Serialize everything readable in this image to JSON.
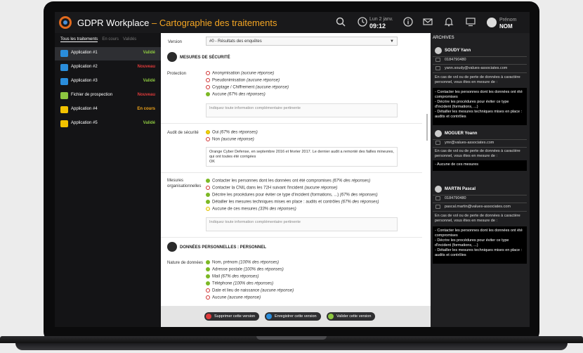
{
  "header": {
    "title_main": "GDPR Workplace",
    "title_dash": " – ",
    "title_sub": "Cartographie des traitements",
    "clock_date": "Lun 2 janv.",
    "clock_time": "09:12",
    "user_firstname": "Prénom",
    "user_lastname": "NOM"
  },
  "left_tabs": [
    "Tous les traitements",
    "En cours",
    "Validés"
  ],
  "applications": [
    {
      "name": "Application #1",
      "status": "Validé",
      "status_color": "#8cc640",
      "icon": "folder-yellow"
    },
    {
      "name": "Application #2",
      "status": "Nouveau",
      "status_color": "#e03b3b",
      "icon": "folder-yellow"
    },
    {
      "name": "Application #3",
      "status": "Validé",
      "status_color": "#8cc640",
      "icon": "folder-yellow"
    },
    {
      "name": "Fichier de prospection",
      "status": "Nouveau",
      "status_color": "#e03b3b",
      "icon": "file-green"
    },
    {
      "name": "Application #4",
      "status": "En cours",
      "status_color": "#f2a51a",
      "icon": "folder-yellow"
    },
    {
      "name": "Application #5",
      "status": "Validé",
      "status_color": "#8cc640",
      "icon": "folder-yellow"
    }
  ],
  "main": {
    "version_label": "Version",
    "version_value": "#0 - Résultats des enquêtes",
    "section_security": "MESURES DE SÉCURITÉ",
    "protection_label": "Protection",
    "protection_options": [
      {
        "text": "Anonymisation ",
        "note": "(aucune réponse)",
        "state": "empty"
      },
      {
        "text": "Pseudonimisation ",
        "note": "(aucune réponse)",
        "state": "empty"
      },
      {
        "text": "Cryptage / Chiffrement ",
        "note": "(aucune réponse)",
        "state": "empty"
      },
      {
        "text": "Aucune ",
        "note": "(67% des réponses)",
        "state": "checked"
      }
    ],
    "placeholder_info": "Indiquez toute information complémentaire pertinente",
    "audit_label": "Audit de sécurité",
    "audit_options": [
      {
        "text": "Oui ",
        "note": "(67% des réponses)",
        "state": "yellow"
      },
      {
        "text": "Non ",
        "note": "(aucune réponse)",
        "state": "empty"
      }
    ],
    "audit_text": "Orange Cyber Defense, en septembre 2016 et février 2017. Le dernier audit a remonté des failles mineures, qui ont toutes été corrigées\nOK",
    "measures_label": "Mesures organisationnelles",
    "measures_options": [
      {
        "text": "Contacter les personnes dont les données ont été compromises ",
        "note": "(67% des réponses)",
        "state": "checked"
      },
      {
        "text": "Contacter la CNIL dans les 72H suivant l'incident ",
        "note": "(aucune réponse)",
        "state": "empty"
      },
      {
        "text": "Décrire les procédures pour éviter ce type d'incident (formations, ...) ",
        "note": "(67% des réponses)",
        "state": "checked"
      },
      {
        "text": "Détailler les mesures techniques mises en place : audits et contrôles ",
        "note": "(67% des réponses)",
        "state": "checked"
      },
      {
        "text": "Aucune de ces mesures ",
        "note": "(33% des réponses)",
        "state": "yellow"
      }
    ],
    "section_personal": "DONNÉES PERSONNELLES : PERSONNEL",
    "nature_label": "Nature de données",
    "nature_options": [
      {
        "text": "Nom, prénom ",
        "note": "(100% des réponses)",
        "state": "checked"
      },
      {
        "text": "Adresse postale ",
        "note": "(100% des réponses)",
        "state": "checked"
      },
      {
        "text": "Mail ",
        "note": "(67% des réponses)",
        "state": "checked"
      },
      {
        "text": "Téléphone ",
        "note": "(100% des réponses)",
        "state": "checked"
      },
      {
        "text": "Date et lieu de naissance ",
        "note": "(aucune réponse)",
        "state": "empty"
      },
      {
        "text": "Aucune ",
        "note": "(aucune réponse)",
        "state": "empty"
      }
    ],
    "buttons": [
      {
        "label": "Supprimer cette version",
        "color": "#e03b3b"
      },
      {
        "label": "Enregistrer cette version",
        "color": "#2a8ddb"
      },
      {
        "label": "Valider cette version",
        "color": "#8cc640"
      }
    ]
  },
  "archives": {
    "title": "ARCHIVES",
    "cards": [
      {
        "name": "SOUDY Yann",
        "phone": "0184790480",
        "email": "yann.soudy@values-associates.com",
        "question": "En cas de vol ou de perte de données à caractère personnel, vous êtes en mesure de :",
        "answer": "- Contacter les personnes dont les données ont été compromises\n- Décrire les procédures pour éviter ce type d'incident (formations, ...)\n- Détailler les mesures techniques mises en place : audits et contrôles"
      },
      {
        "name": "MOGUER Yoann",
        "phone": "",
        "email": "ymr@values-associates.com",
        "question": "En cas de vol ou de perte de données à caractère personnel, vous êtes en mesure de :",
        "answer": "- Aucune de ces mesures"
      },
      {
        "name": "MARTIN Pascal",
        "phone": "0184790480",
        "email": "pascal.martin@values-associates.com",
        "question": "En cas de vol ou de perte de données à caractère personnel, vous êtes en mesure de :",
        "answer": "- Contacter les personnes dont les données ont été compromises\n- Décrire les procédures pour éviter ce type d'incident (formations, ...)\n- Détailler les mesures techniques mises en place : audits et contrôles"
      }
    ]
  }
}
